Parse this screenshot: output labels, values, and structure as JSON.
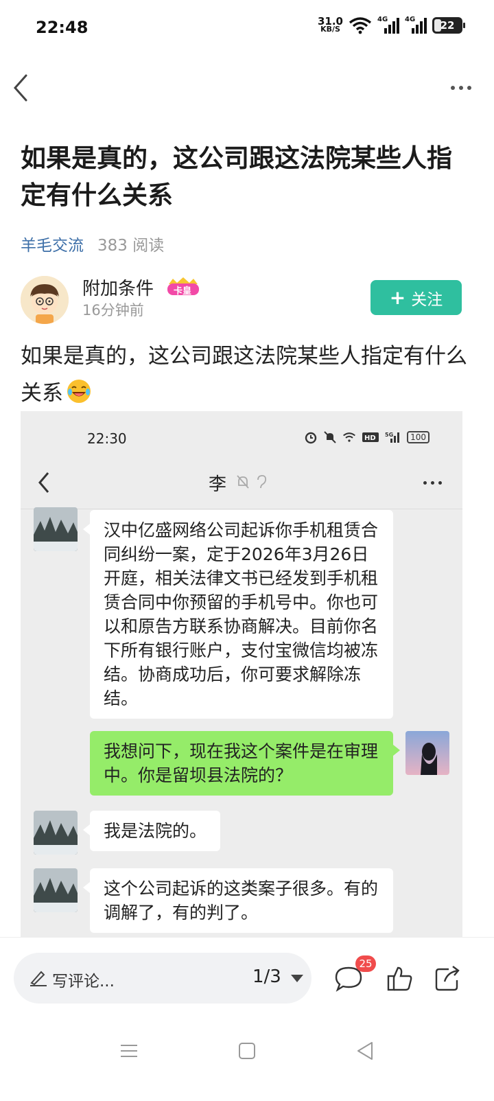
{
  "status_bar": {
    "time": "22:48",
    "net_speed_value": "31.0",
    "net_speed_unit": "KB/S",
    "signal_label_1": "4G",
    "signal_label_2": "4G",
    "battery_level": "22",
    "icons": [
      "wifi-icon",
      "signal-4g-icon",
      "signal-4g-icon",
      "battery-icon"
    ]
  },
  "nav": {
    "back_icon": "chevron-left-icon",
    "more_icon": "more-dots-icon"
  },
  "post": {
    "title": "如果是真的，这公司跟这法院某些人指定有什么关系",
    "topic": "羊毛交流",
    "reads": "383 阅读",
    "body": "如果是真的，这公司跟这法院某些人指定有什么关系"
  },
  "author": {
    "name": "附加条件",
    "badge_text": "卡皇",
    "time": "16分钟前",
    "follow_label": "关注",
    "follow_icon": "plus-icon"
  },
  "screenshot": {
    "time": "22:30",
    "battery": "100",
    "contact_name": "李",
    "messages": [
      {
        "from": "in",
        "text": "汉中亿盛网络公司起诉你手机租赁合同纠纷一案，定于2026年3月26日开庭，相关法律文书已经发到手机租赁合同中你预留的手机号中。你也可以和原告方联系协商解决。目前你名下所有银行账户，支付宝微信均被冻结。协商成功后，你可要求解除冻结。"
      },
      {
        "from": "out",
        "text": "我想问下，现在我这个案件是在审理中。你是留坝县法院的？"
      },
      {
        "from": "in",
        "text": "我是法院的。"
      },
      {
        "from": "in",
        "text": "这个公司起诉的这类案子很多。有的调解了，有的判了。"
      }
    ]
  },
  "bottom_bar": {
    "comment_placeholder": "写评论...",
    "page_indicator": "1/3",
    "comment_count": "25",
    "icons": [
      "pen-icon",
      "comment-icon",
      "like-icon",
      "share-icon"
    ]
  },
  "system_nav": {
    "icons": [
      "menu-icon",
      "home-icon",
      "back-triangle-icon"
    ]
  },
  "colors": {
    "accent": "#2fbf9f",
    "topic": "#3d6fa8",
    "badge": "#f04c4c",
    "outgoing_bubble": "#95ec69"
  }
}
